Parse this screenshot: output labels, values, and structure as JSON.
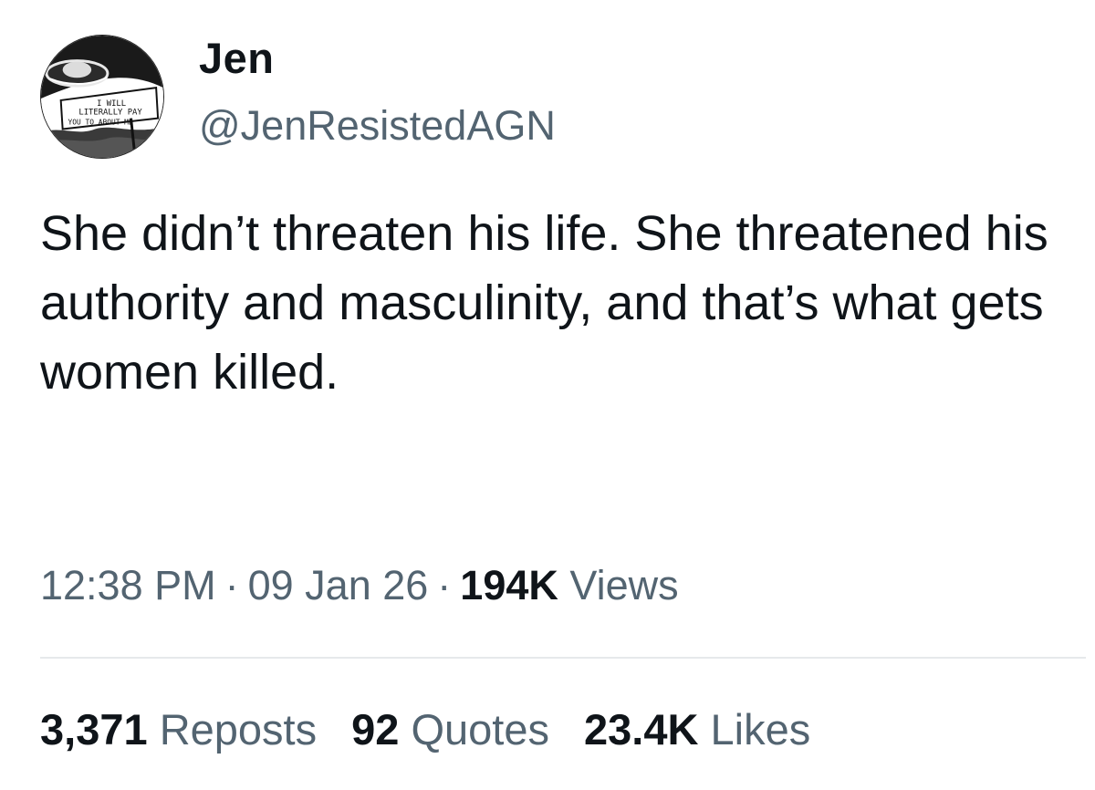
{
  "author": {
    "display_name": "Jen",
    "handle": "@JenResistedAGN",
    "avatar": {
      "icon": "avatar-image",
      "sign_text": [
        "I WILL",
        "LITERALLY PAY",
        "YOU TO ABOUT ME"
      ]
    }
  },
  "tweet": {
    "text": "She didn’t threaten his life. She threatened his authority and masculinity, and that’s what gets women killed."
  },
  "meta": {
    "time": "12:38 PM",
    "date": "09 Jan 26",
    "views_count": "194K",
    "views_label": "Views",
    "separator": "·"
  },
  "stats": {
    "reposts_count": "3,371",
    "reposts_label": "Reposts",
    "quotes_count": "92",
    "quotes_label": "Quotes",
    "likes_count": "23.4K",
    "likes_label": "Likes"
  },
  "colors": {
    "text_primary": "#0f1419",
    "text_secondary": "#536471",
    "divider": "#e6e9eb"
  }
}
